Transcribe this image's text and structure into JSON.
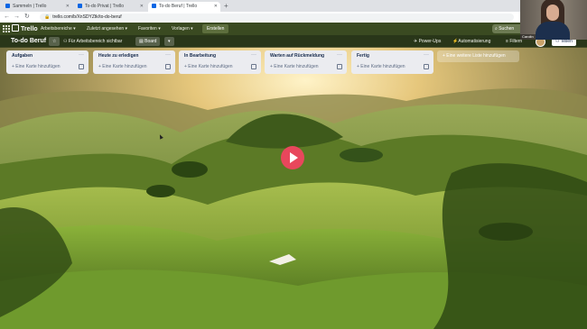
{
  "browser": {
    "tabs": [
      {
        "title": "Sammeln | Trello"
      },
      {
        "title": "To-do Privat | Trello"
      },
      {
        "title": "To-do Beruf | Trello"
      }
    ],
    "new_tab": "+",
    "url": "trello.com/b/XnSDYZtk/to-do-beruf"
  },
  "header": {
    "logo": "Trello",
    "menu": [
      "Arbeitsbereiche ▾",
      "Zuletzt angesehen ▾",
      "Favoriten ▾",
      "Vorlagen ▾"
    ],
    "create": "Erstellen",
    "search": "Suchen"
  },
  "board": {
    "title": "To-do Beruf",
    "view": "Board",
    "visibility": "Für Arbeitsbereich sichtbar",
    "power_ups": "Power-Ups",
    "automation": "Automatisierung",
    "filter": "Filtern",
    "share": "Teilen"
  },
  "lists": [
    {
      "title": "Aufgaben",
      "add": "+ Eine Karte hinzufügen"
    },
    {
      "title": "Heute zu erledigen",
      "add": "+ Eine Karte hinzufügen"
    },
    {
      "title": "In Bearbeitung",
      "add": "+ Eine Karte hinzufügen"
    },
    {
      "title": "Warten auf Rückmeldung",
      "add": "+ Eine Karte hinzufügen"
    },
    {
      "title": "Fertig",
      "add": "+ Eine Karte hinzufügen"
    }
  ],
  "add_list": "+ Eine weitere Liste hinzufügen",
  "webcam": {
    "name": "Carolin"
  },
  "colors": {
    "accent": "#e8475c",
    "header": "#3a4a21",
    "list_bg": "#ebecf0"
  },
  "icons": [
    "apps-grid-icon",
    "trello-logo-icon",
    "star-icon",
    "play-icon",
    "lock-icon",
    "ellipsis-icon",
    "card-template-icon"
  ]
}
